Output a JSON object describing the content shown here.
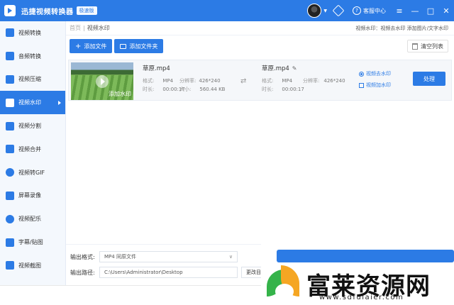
{
  "window": {
    "title": "迅捷视频转换器",
    "badge": "极速版",
    "help_label": "客服中心",
    "min": "—",
    "max": "□",
    "close": "✕",
    "menu": "≡"
  },
  "sidebar": {
    "items": [
      {
        "label": "视频转换",
        "icon": "video-convert-icon"
      },
      {
        "label": "音频转换",
        "icon": "audio-convert-icon"
      },
      {
        "label": "视频压缩",
        "icon": "video-compress-icon"
      },
      {
        "label": "视频水印",
        "icon": "video-watermark-icon",
        "active": true
      },
      {
        "label": "视频分割",
        "icon": "video-split-icon"
      },
      {
        "label": "视频合并",
        "icon": "video-merge-icon"
      },
      {
        "label": "视频转GIF",
        "icon": "video-gif-icon"
      },
      {
        "label": "屏幕录像",
        "icon": "screen-record-icon"
      },
      {
        "label": "视频配乐",
        "icon": "video-music-icon"
      },
      {
        "label": "字幕/贴图",
        "icon": "subtitle-icon"
      },
      {
        "label": "视频截图",
        "icon": "video-screenshot-icon"
      }
    ]
  },
  "breadcrumb": {
    "home": "首页",
    "sep": "|",
    "current": "视频水印",
    "right_hint": "视频水印：视频去水印 添加图片/文字水印"
  },
  "toolbar": {
    "add_file": "添加文件",
    "add_folder": "添加文件夹",
    "clear_list": "清空列表"
  },
  "file": {
    "thumb_overlay": "添加水印",
    "source": {
      "name": "草原.mp4",
      "format_label": "格式:",
      "format": "MP4",
      "resolution_label": "分辨率:",
      "resolution": "426*240",
      "duration_label": "时长:",
      "duration": "00:00:17",
      "size_label": "大小:",
      "size": "560.44 KB"
    },
    "output": {
      "name": "草原.mp4",
      "format_label": "格式:",
      "format": "MP4",
      "resolution_label": "分辨率:",
      "resolution": "426*240",
      "duration_label": "时长:",
      "duration": "00:00:17"
    },
    "option_remove": "视频去水印",
    "option_add": "视频加水印",
    "process": "处理"
  },
  "output": {
    "format_label": "输出格式:",
    "format_value": "MP4  同原文件",
    "path_label": "输出路径:",
    "path_value": "C:\\Users\\Administrator\\Desktop",
    "change_label": "更改目"
  },
  "site_watermark": {
    "name": "富莱资源网",
    "url": "www.sdfulaier.com"
  }
}
